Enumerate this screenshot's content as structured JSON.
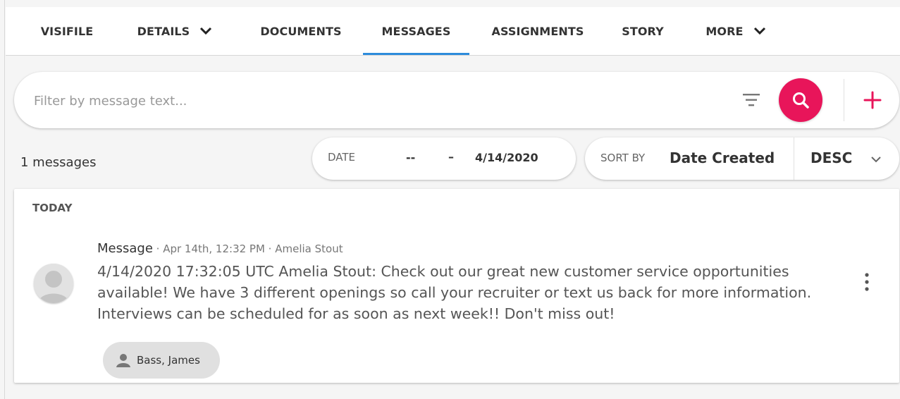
{
  "tabs": [
    {
      "label": "VISIFILE",
      "has_dropdown": false,
      "active": false
    },
    {
      "label": "DETAILS",
      "has_dropdown": true,
      "active": false
    },
    {
      "label": "DOCUMENTS",
      "has_dropdown": false,
      "active": false
    },
    {
      "label": "MESSAGES",
      "has_dropdown": false,
      "active": true
    },
    {
      "label": "ASSIGNMENTS",
      "has_dropdown": false,
      "active": false
    },
    {
      "label": "STORY",
      "has_dropdown": false,
      "active": false
    },
    {
      "label": "MORE",
      "has_dropdown": true,
      "active": false
    }
  ],
  "search": {
    "placeholder": "Filter by message text...",
    "value": "",
    "filter_icon": "filter-lines-icon",
    "search_icon": "magnifier-icon",
    "add_icon": "plus-icon"
  },
  "results": {
    "count_text": "1 messages"
  },
  "date_filter": {
    "label": "DATE",
    "from": "--",
    "separator": "–",
    "to": "4/14/2020"
  },
  "sort": {
    "label": "SORT BY",
    "field": "Date Created",
    "direction": "DESC"
  },
  "groups": [
    {
      "title": "TODAY",
      "messages": [
        {
          "type": "Message",
          "meta": " · Apr 14th, 12:32 PM · Amelia Stout",
          "body": "4/14/2020 17:32:05 UTC Amelia Stout: Check out our great new customer service opportunities available! We have 3 different openings so call your recruiter or text us back for more information. Interviews can be scheduled for as soon as next week!! Don't miss out!",
          "recipient": "Bass, James"
        }
      ]
    }
  ],
  "colors": {
    "accent": "#e8155a",
    "active_tab": "#2d8cdc",
    "background": "#f5f5f5"
  }
}
